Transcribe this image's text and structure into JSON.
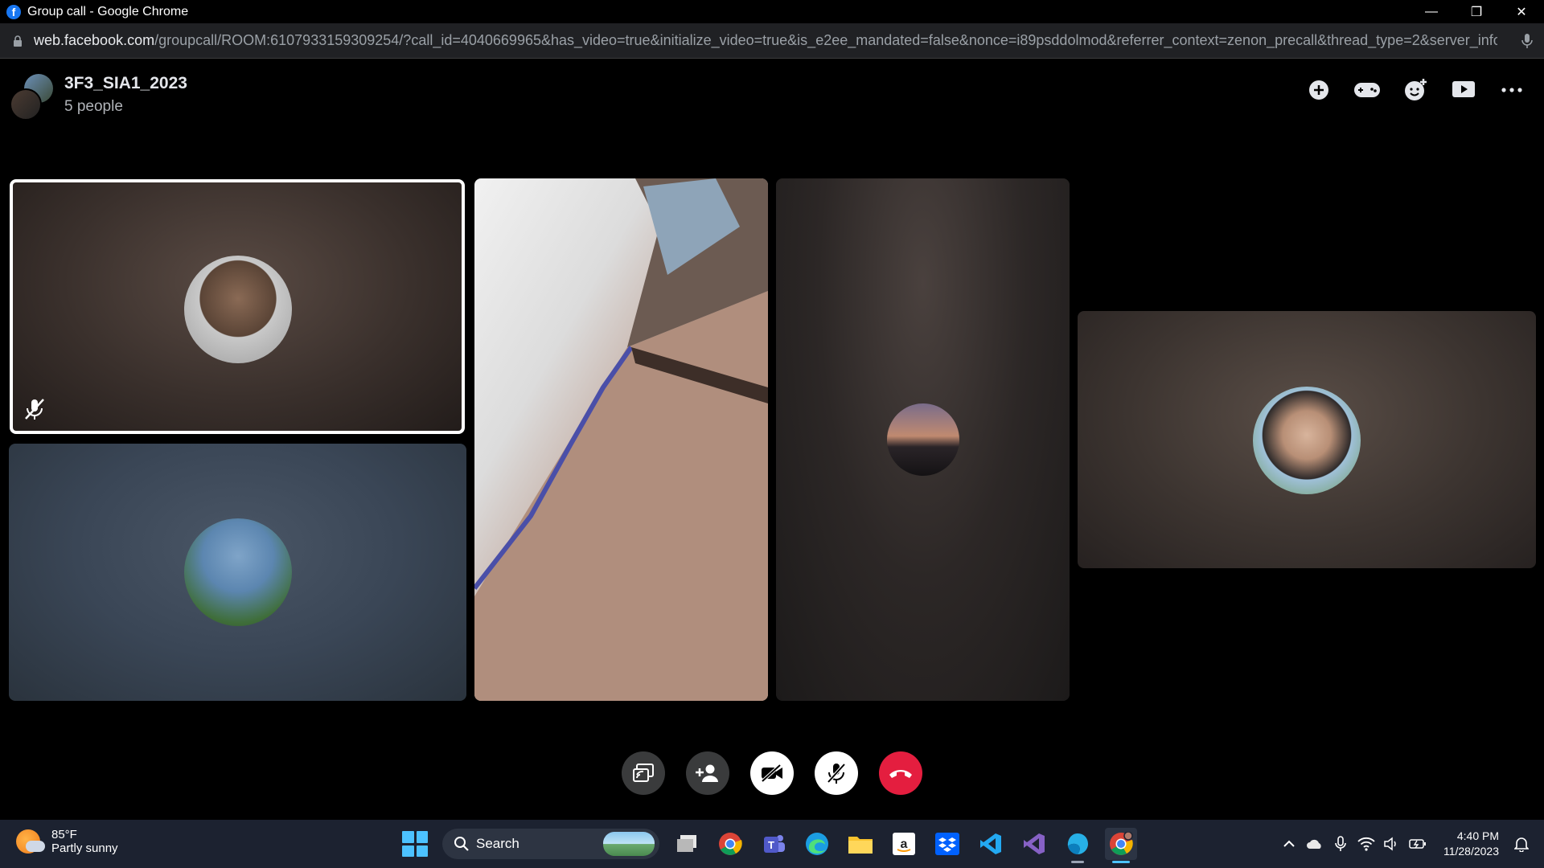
{
  "window": {
    "title": "Group call - Google Chrome",
    "controls": [
      "minimize",
      "restore",
      "close"
    ]
  },
  "address_bar": {
    "host": "web.facebook.com",
    "path": "/groupcall/ROOM:6107933159309254/?call_id=4040669965&has_video=true&initialize_video=true&is_e2ee_mandated=false&nonce=i89psddolmod&referrer_context=zenon_precall&thread_type=2&server_info_data..."
  },
  "call_header": {
    "group_name": "3F3_SIA1_2023",
    "people_count": "5 people",
    "actions": [
      "add-circle-icon",
      "game-controller-icon",
      "add-emoji-icon",
      "share-screen-icon",
      "more-options-icon"
    ]
  },
  "participants": [
    {
      "id": "p1",
      "video": false,
      "muted": true,
      "active_speaker": true
    },
    {
      "id": "p2",
      "video": false,
      "muted": false
    },
    {
      "id": "p3",
      "video": true,
      "muted": false
    },
    {
      "id": "p4",
      "video": false,
      "muted": false
    },
    {
      "id": "p5",
      "video": false,
      "muted": false
    }
  ],
  "call_controls": [
    "screen-share-icon",
    "add-person-icon",
    "camera-off-icon",
    "mic-off-icon",
    "end-call-icon"
  ],
  "taskbar": {
    "weather_temp": "85°F",
    "weather_desc": "Partly sunny",
    "search_label": "Search",
    "apps": [
      "task-view",
      "chrome",
      "teams",
      "edge",
      "file-explorer",
      "amazon",
      "dropbox",
      "vscode",
      "visual-studio",
      "edge-dev",
      "chrome-active"
    ],
    "time": "4:40 PM",
    "date": "11/28/2023"
  },
  "colors": {
    "accent_blue": "#1877f2",
    "end_call_red": "#e41e3f",
    "taskbar_bg": "#1c2230"
  }
}
